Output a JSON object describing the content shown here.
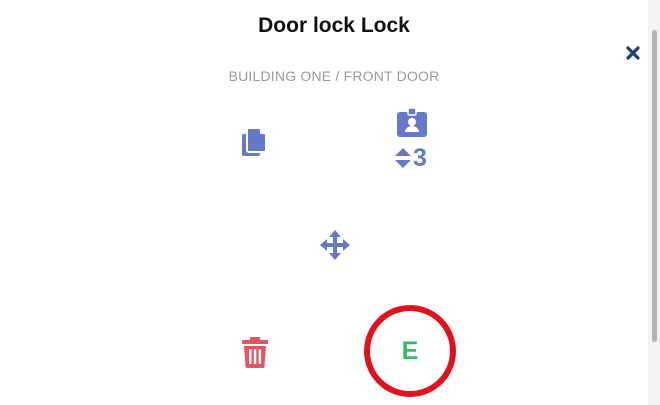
{
  "dialog": {
    "title": "Door lock Lock",
    "breadcrumb": "BUILDING ONE / FRONT DOOR"
  },
  "actions": {
    "copy_icon": "copy-icon",
    "badge_icon": "id-badge-icon",
    "badge_sort_icon": "sort-icon",
    "badge_count": "3",
    "move_icon": "move-icon",
    "delete_icon": "trash-icon",
    "e_label": "E"
  },
  "colors": {
    "icon_blue": "#6678c8",
    "delete_red": "#e5535f",
    "e_green": "#3bb86a",
    "highlight_red": "#e0121d",
    "close_navy": "#1f3a7a"
  }
}
